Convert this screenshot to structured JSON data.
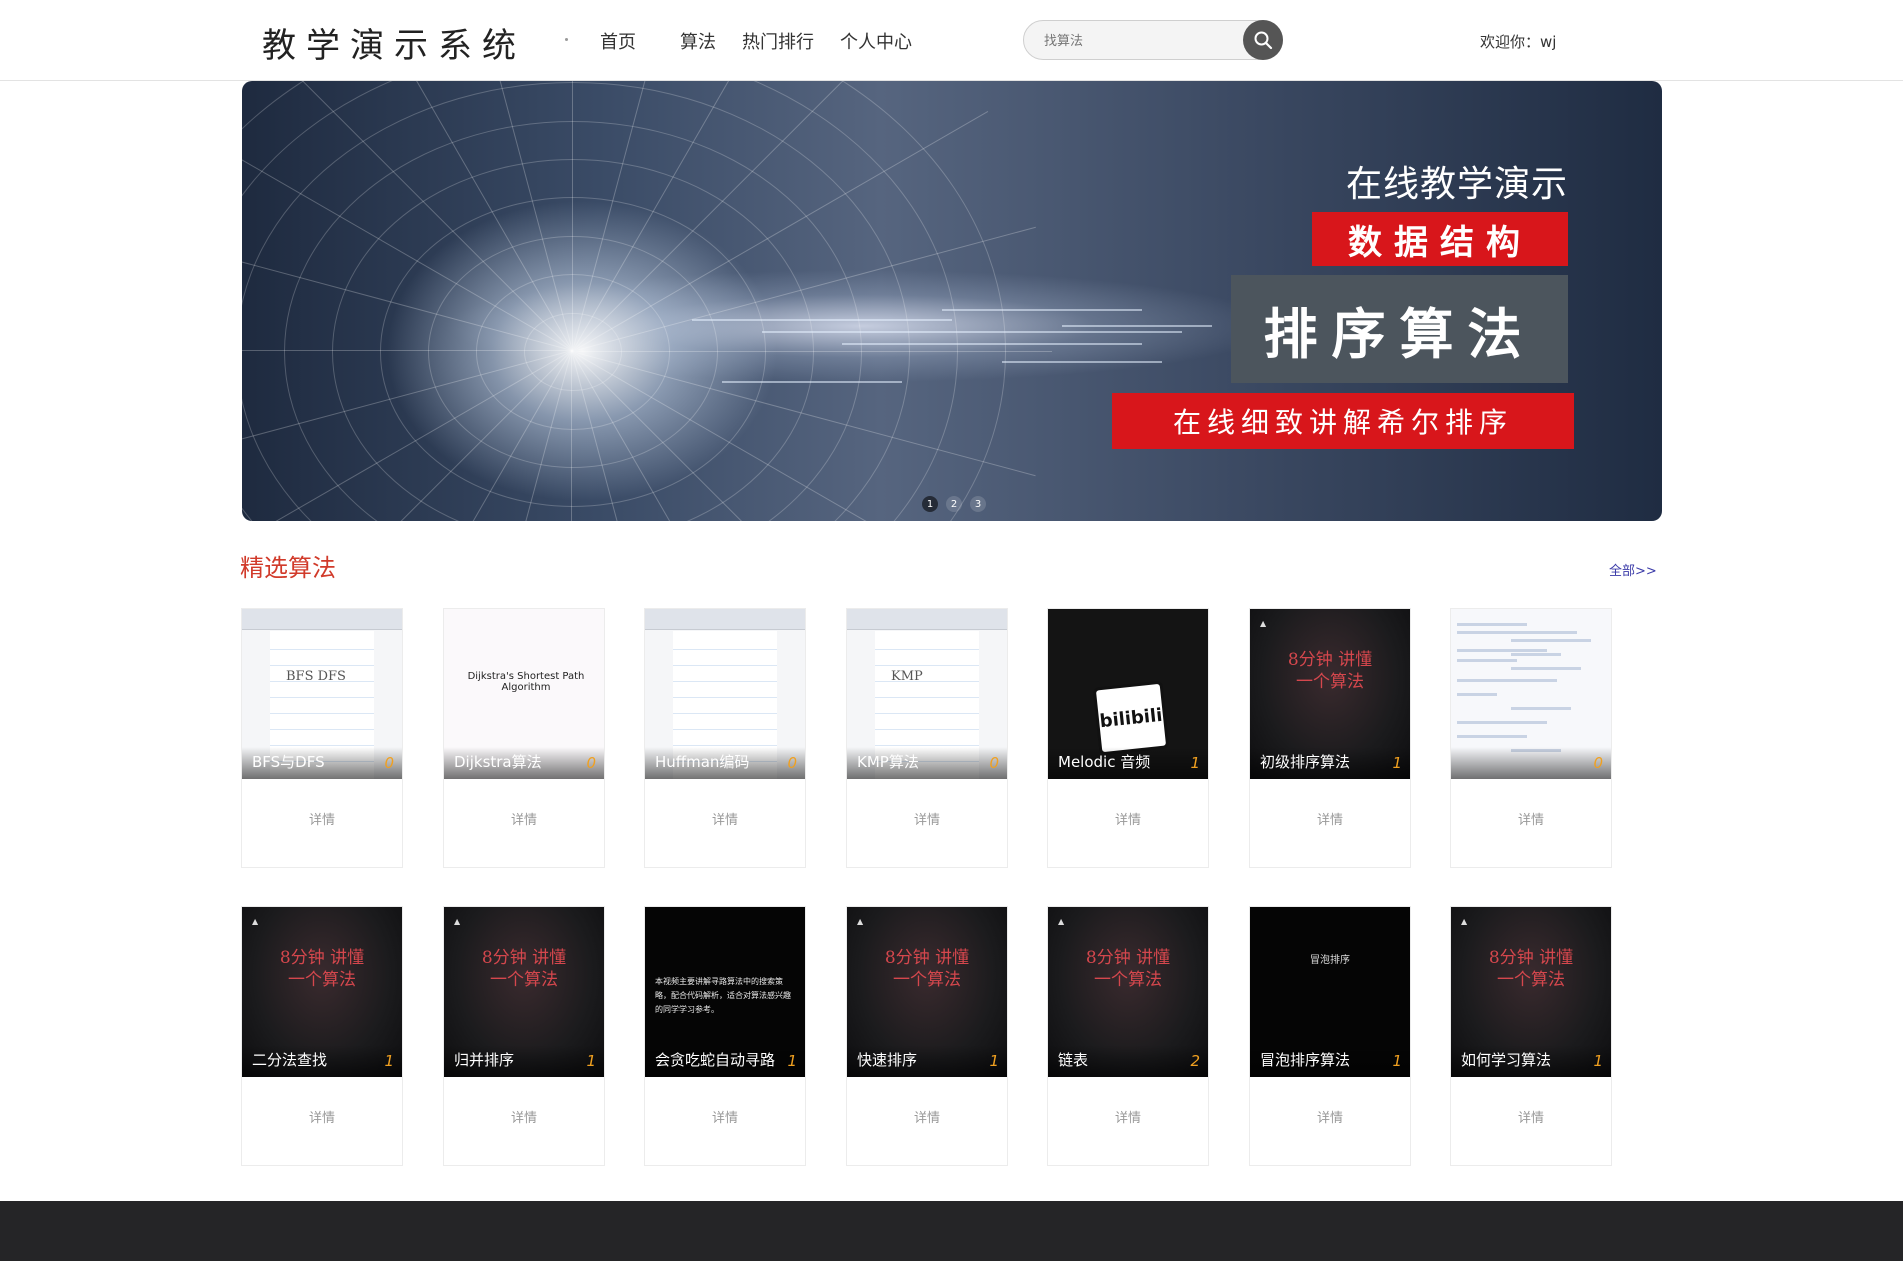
{
  "header": {
    "logo": "教学演示系统",
    "nav": [
      "首页",
      "算法",
      "热门排行",
      "个人中心"
    ],
    "search_placeholder": "找算法",
    "welcome": "欢迎你：wj"
  },
  "banner": {
    "line1": "在线教学演示",
    "line2": "数据结构",
    "line3": "排序算法",
    "line4": "在线细致讲解希尔排序",
    "dots": [
      "1",
      "2",
      "3"
    ],
    "active_dot": 1
  },
  "section": {
    "title": "精选算法",
    "more": "全部>>",
    "detail_label": "详情"
  },
  "cards": [
    {
      "name": "BFS与DFS",
      "count": "0",
      "style": "paper",
      "thumb_text": "BFS  DFS"
    },
    {
      "name": "Dijkstra算法",
      "count": "0",
      "style": "white",
      "thumb_text": "Dijkstra's Shortest Path Algorithm"
    },
    {
      "name": "Huffman编码",
      "count": "0",
      "style": "paper",
      "thumb_text": ""
    },
    {
      "name": "KMP算法",
      "count": "0",
      "style": "paper",
      "thumb_text": "KMP"
    },
    {
      "name": "Melodic 音频",
      "count": "1",
      "style": "bili",
      "thumb_text": "bilibili"
    },
    {
      "name": "初级排序算法",
      "count": "1",
      "style": "dark",
      "thumb_text": "8分钟 讲懂一个算法"
    },
    {
      "name": "",
      "count": "0",
      "style": "code",
      "thumb_text": ""
    },
    {
      "name": "二分法查找",
      "count": "1",
      "style": "dark",
      "thumb_text": "8分钟 讲懂一个算法"
    },
    {
      "name": "归并排序",
      "count": "1",
      "style": "dark",
      "thumb_text": "8分钟 讲懂一个算法"
    },
    {
      "name": "会贪吃蛇自动寻路",
      "count": "1",
      "style": "black",
      "thumb_text": "本视频主要讲解寻路算法中的搜索策略，配合代码解析，适合对算法感兴趣的同学学习参考。"
    },
    {
      "name": "快速排序",
      "count": "1",
      "style": "dark",
      "thumb_text": "8分钟 讲懂一个算法"
    },
    {
      "name": "链表",
      "count": "2",
      "style": "dark",
      "thumb_text": "8分钟 讲懂一个算法"
    },
    {
      "name": "冒泡排序算法",
      "count": "1",
      "style": "black2",
      "thumb_text": "冒泡排序"
    },
    {
      "name": "如何学习算法",
      "count": "1",
      "style": "dark",
      "thumb_text": "8分钟 讲懂一个算法"
    }
  ],
  "colors": {
    "accent_red": "#d8161b",
    "section_title": "#d13a2a",
    "count_orange": "#f0a020",
    "footer": "#252527"
  }
}
